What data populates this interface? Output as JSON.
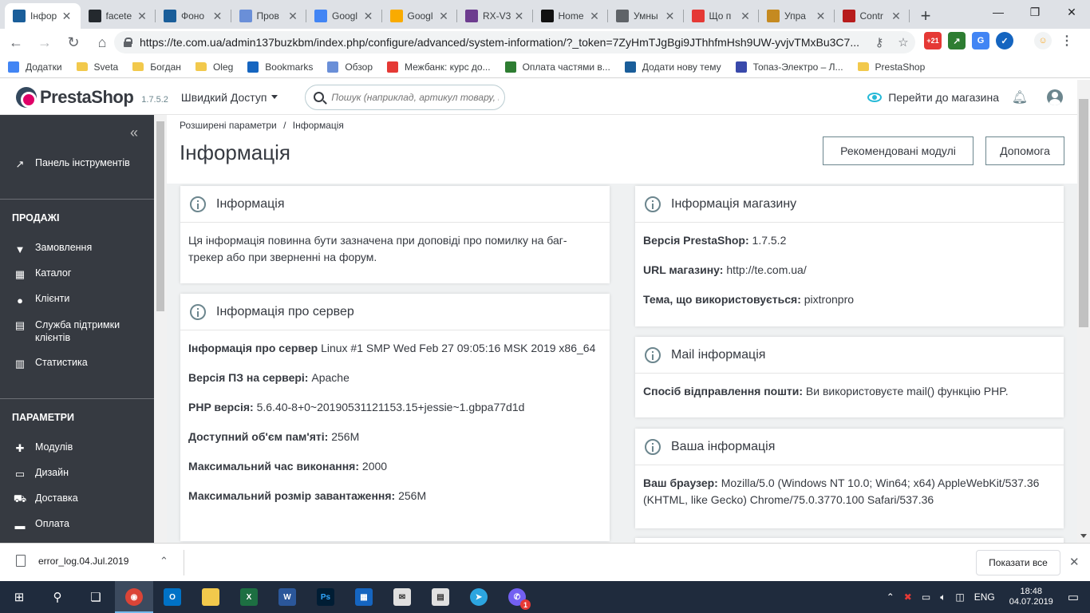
{
  "browser": {
    "tabs": [
      {
        "title": "Інфор",
        "icon": "prestashop-icon",
        "color": "#1a5e9a",
        "active": true
      },
      {
        "title": "facete",
        "icon": "github-icon",
        "color": "#24292e"
      },
      {
        "title": "Фоно",
        "icon": "prestashop-icon",
        "color": "#1a5e9a"
      },
      {
        "title": "Пров",
        "icon": "hourglass-icon",
        "color": "#6a8fd8"
      },
      {
        "title": "Googl",
        "icon": "google-translate-icon",
        "color": "#4285f4"
      },
      {
        "title": "Googl",
        "icon": "google-analytics-icon",
        "color": "#f9ab00"
      },
      {
        "title": "RX-V3",
        "icon": "yamaha-icon",
        "color": "#6d3c8f"
      },
      {
        "title": "Home",
        "icon": "home-icon",
        "color": "#111111"
      },
      {
        "title": "Умны",
        "icon": "globe-icon",
        "color": "#5f6368"
      },
      {
        "title": "Що п",
        "icon": "star-icon",
        "color": "#e53935"
      },
      {
        "title": "Упра",
        "icon": "h-icon",
        "color": "#c58a20"
      },
      {
        "title": "Contr",
        "icon": "house-icon",
        "color": "#b71c1c"
      }
    ],
    "url": "https://te.com.ua/admin137buzkbm/index.php/configure/advanced/system-information/?_token=7ZyHmTJgBgi9JThhfmHsh9UW-yvjvTMxBu3C7...",
    "ext_badge": "+21",
    "bookmarks": [
      {
        "label": "Додатки",
        "icon": "apps-icon"
      },
      {
        "label": "Sveta",
        "icon": "folder-icon"
      },
      {
        "label": "Богдан",
        "icon": "folder-icon"
      },
      {
        "label": "Oleg",
        "icon": "folder-icon"
      },
      {
        "label": "Bookmarks",
        "icon": "star-icon"
      },
      {
        "label": "Обзор",
        "icon": "hourglass-icon"
      },
      {
        "label": "Межбанк: курс до...",
        "icon": "minfin-icon"
      },
      {
        "label": "Оплата частями в...",
        "icon": "arrow-icon"
      },
      {
        "label": "Додати нову тему",
        "icon": "prestashop-icon"
      },
      {
        "label": "Топаз-Электро – Л...",
        "icon": "topaz-icon"
      },
      {
        "label": "PrestaShop",
        "icon": "folder-icon"
      }
    ]
  },
  "header": {
    "logo": "PrestaShop",
    "version": "1.7.5.2",
    "quick_access": "Швидкий Доступ",
    "search_placeholder": "Пошук (наприклад, артикул товару, ім'я клієнта...)",
    "go_to_store": "Перейти до магазина"
  },
  "sidebar": {
    "dashboard": "Панель інструментів",
    "sales_heading": "ПРОДАЖІ",
    "sales_items": [
      "Замовлення",
      "Каталог",
      "Клієнти",
      "Служба підтримки клієнтів",
      "Статистика"
    ],
    "params_heading": "ПАРАМЕТРИ",
    "params_items": [
      "Модулів",
      "Дизайн",
      "Доставка",
      "Оплата"
    ]
  },
  "page": {
    "breadcrumb_1": "Розширені параметри",
    "breadcrumb_sep": "/",
    "breadcrumb_2": "Інформація",
    "title": "Інформація",
    "btn_recommended": "Рекомендовані модулі",
    "btn_help": "Допомога"
  },
  "cards": {
    "info": {
      "title": "Інформація",
      "text": "Ця інформація повинна бути зазначена при доповіді про помилку на баг-трекер або при зверненні на форум."
    },
    "server": {
      "title": "Інформація про сервер",
      "rows": [
        {
          "label": "Інформація про сервер",
          "value": "Linux #1 SMP Wed Feb 27 09:05:16 MSK 2019 x86_64"
        },
        {
          "label": "Версія ПЗ на сервері:",
          "value": "Apache"
        },
        {
          "label": "PHP версія:",
          "value": "5.6.40-8+0~20190531121153.15+jessie~1.gbpa77d1d"
        },
        {
          "label": "Доступний об'єм пам'яті:",
          "value": "256M"
        },
        {
          "label": "Максимальний час виконання:",
          "value": "2000"
        },
        {
          "label": "Максимальний розмір завантаження:",
          "value": "256M"
        }
      ]
    },
    "store": {
      "title": "Інформація магазину",
      "rows": [
        {
          "label": "Версія PrestaShop:",
          "value": "1.7.5.2"
        },
        {
          "label": "URL магазину:",
          "value": "http://te.com.ua/"
        },
        {
          "label": "Тема, що використовується:",
          "value": "pixtronpro"
        }
      ]
    },
    "mail": {
      "title": "Mail інформація",
      "rows": [
        {
          "label": "Спосіб відправлення пошти:",
          "value": "Ви використовуєте mail() функцію PHP."
        }
      ]
    },
    "yours": {
      "title": "Ваша інформація",
      "rows": [
        {
          "label": "Ваш браузер:",
          "value": "Mozilla/5.0 (Windows NT 10.0; Win64; x64) AppleWebKit/537.36 (KHTML, like Gecko) Chrome/75.0.3770.100 Safari/537.36"
        }
      ]
    }
  },
  "downloads": {
    "file": "error_log.04.Jul.2019",
    "show_all": "Показати все"
  },
  "taskbar": {
    "lang": "ENG",
    "time": "18:48",
    "date": "04.07.2019",
    "viber_badge": "1"
  },
  "colors": {
    "accent": "#25b9d7",
    "sidebar": "#363a41",
    "brand_pink": "#df0067"
  }
}
